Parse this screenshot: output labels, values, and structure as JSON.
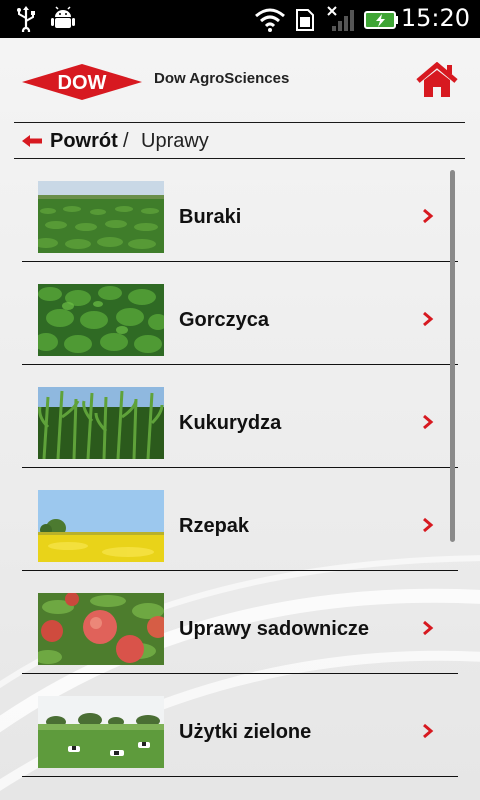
{
  "status_bar": {
    "time": "15:20",
    "icons": [
      "usb-icon",
      "android-debug-icon",
      "wifi-icon",
      "sim-card-icon",
      "no-signal-icon",
      "battery-charging-icon"
    ]
  },
  "header": {
    "logo_text": "DOW",
    "brand_name": "Dow AgroSciences",
    "home_icon": "home-icon"
  },
  "breadcrumb": {
    "back_label": "Powrót",
    "separator": "/",
    "current": "Uprawy"
  },
  "colors": {
    "brand_red": "#d71920",
    "text": "#111111",
    "background": "#eeeeee"
  },
  "items": [
    {
      "label": "Buraki",
      "image": "sugar-beet-field"
    },
    {
      "label": "Gorczyca",
      "image": "mustard-leaves"
    },
    {
      "label": "Kukurydza",
      "image": "corn-field"
    },
    {
      "label": "Rzepak",
      "image": "rapeseed-field"
    },
    {
      "label": "Uprawy sadownicze",
      "image": "apples-orchard"
    },
    {
      "label": "Użytki zielone",
      "image": "pasture-with-cows"
    }
  ]
}
